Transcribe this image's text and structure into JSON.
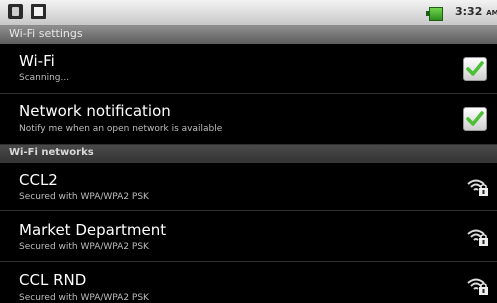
{
  "statusbar": {
    "time": "3:32",
    "ampm": "AM",
    "icons": [
      "usb-icon",
      "sd-card-icon",
      "battery-icon"
    ],
    "battery_color": "#4cc23a"
  },
  "header": {
    "title": "Wi-Fi settings"
  },
  "settings": {
    "wifi": {
      "title": "Wi-Fi",
      "subtitle": "Scanning...",
      "checked": true
    },
    "notification": {
      "title": "Network notification",
      "subtitle": "Notify me when an open network is available",
      "checked": true
    }
  },
  "networks_header": "Wi-Fi networks",
  "networks": [
    {
      "name": "CCL2",
      "security": "Secured with WPA/WPA2 PSK",
      "icon": "wifi-lock-icon"
    },
    {
      "name": "Market Department",
      "security": "Secured with WPA/WPA2 PSK",
      "icon": "wifi-lock-icon"
    },
    {
      "name": "CCL RND",
      "security": "Secured with WPA/WPA2 PSK",
      "icon": "wifi-lock-icon"
    }
  ],
  "colors": {
    "check": "#4bbf36",
    "background": "#000000",
    "divider": "#2f2f2f"
  }
}
